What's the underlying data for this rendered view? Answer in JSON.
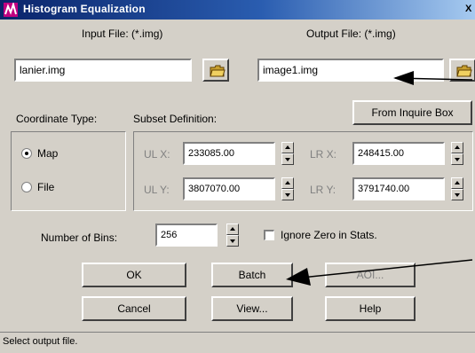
{
  "window": {
    "title": "Histogram Equalization",
    "close_label": "X"
  },
  "input_file": {
    "label": "Input File: (*.img)",
    "value": "lanier.img"
  },
  "output_file": {
    "label": "Output File: (*.img)",
    "value": "image1.img"
  },
  "coordinate_type": {
    "label": "Coordinate Type:",
    "options": [
      {
        "label": "Map",
        "checked": true
      },
      {
        "label": "File",
        "checked": false
      }
    ]
  },
  "subset_definition": {
    "label": "Subset Definition:",
    "from_inquire_label": "From Inquire Box",
    "ul_x": {
      "label": "UL X:",
      "value": "233085.00"
    },
    "ul_y": {
      "label": "UL Y:",
      "value": "3807070.00"
    },
    "lr_x": {
      "label": "LR X:",
      "value": "248415.00"
    },
    "lr_y": {
      "label": "LR Y:",
      "value": "3791740.00"
    }
  },
  "bins": {
    "label": "Number of Bins:",
    "value": "256"
  },
  "ignore_zero": {
    "label": "Ignore Zero in Stats.",
    "checked": false
  },
  "buttons": {
    "ok": "OK",
    "batch": "Batch",
    "aoi": "AOI...",
    "cancel": "Cancel",
    "view": "View...",
    "help": "Help"
  },
  "status": {
    "text": "Select output file."
  },
  "icons": {
    "title": "app-icon",
    "input_browse": "folder-open-icon",
    "output_browse": "folder-open-icon",
    "spinner": "spinner-arrows-icon"
  },
  "colors": {
    "title_bar_start": "#0a246a",
    "title_bar_end": "#a6caf0",
    "dialog_face": "#d4d0c8",
    "annotation_arrow": "#000000"
  }
}
